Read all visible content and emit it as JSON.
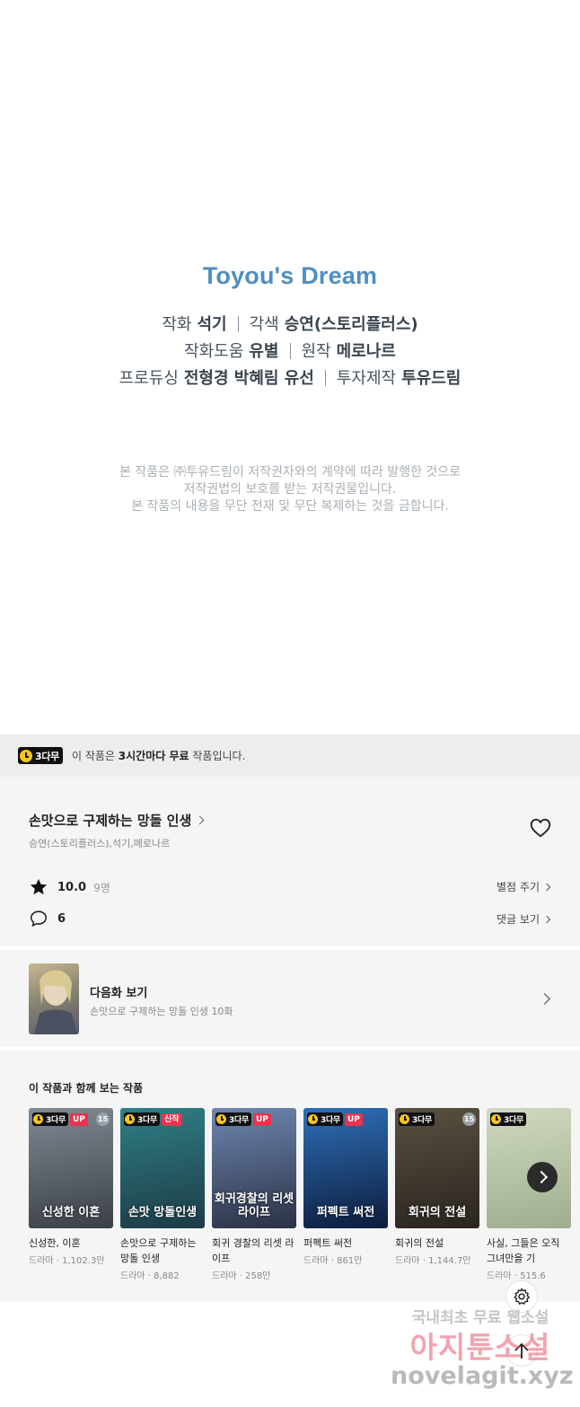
{
  "credits": {
    "logo": "Toyou's Dream",
    "lines": [
      [
        {
          "role": "작화",
          "name": "석기"
        },
        {
          "role": "각색",
          "name": "승연(스토리플러스)"
        }
      ],
      [
        {
          "role": "작화도움",
          "name": "유별"
        },
        {
          "role": "원작",
          "name": "메로나르"
        }
      ],
      [
        {
          "role": "프로듀싱",
          "name": "전형경 박혜림 유선"
        },
        {
          "role": "투자제작",
          "name": "투유드림"
        }
      ]
    ],
    "notice": [
      "본 작품은 ㈜투유드림이 저작권자와의 계약에 따라 발행한 것으로",
      "저작권법의 보호를 받는 저작권물입니다.",
      "본 작품의 내용을 무단 전재 및 무단 복제하는 것을 금합니다."
    ]
  },
  "free_banner": {
    "badge": "3다무",
    "text_before": "이 작품은 ",
    "text_bold": "3시간마다 무료",
    "text_after": " 작품입니다."
  },
  "info": {
    "title": "손맛으로 구제하는 망돌 인생",
    "authors": "승연(스토리플러스),석기,메로나르",
    "rating": "10.0",
    "rating_count": "9명",
    "rate_link": "별점 주기",
    "comments": "6",
    "comments_link": "댓글 보기"
  },
  "next_episode": {
    "label": "다음화 보기",
    "subtitle": "손맛으로 구제하는 망돌 인생 10화"
  },
  "recommendations": {
    "heading": "이 작품과 함께 보는 작품",
    "items": [
      {
        "title": "신성한, 이혼",
        "meta": "드라마 · 1,102.3만",
        "badge": "3다무",
        "tag": "UP",
        "age": "15",
        "cover_text": "신성한 이혼",
        "colors": [
          "#7f8a93",
          "#3b4046"
        ]
      },
      {
        "title": "손맛으로 구제하는 망돌 인생",
        "meta": "드라마 · 8,882",
        "badge": "3다무",
        "tag": "신작",
        "age": "",
        "cover_text": "손맛 망돌인생",
        "colors": [
          "#2f7f86",
          "#1d3b46"
        ]
      },
      {
        "title": "회귀 경찰의 리셋 라이프",
        "meta": "드라마 · 258만",
        "badge": "3다무",
        "tag": "UP",
        "age": "",
        "cover_text": "회귀경찰의 리셋라이프",
        "colors": [
          "#6e86b0",
          "#2b3245"
        ]
      },
      {
        "title": "퍼펙트 써전",
        "meta": "드라마 · 861만",
        "badge": "3다무",
        "tag": "UP",
        "age": "",
        "cover_text": "퍼펙트 써전",
        "colors": [
          "#2e6fb8",
          "#0d1d3c"
        ]
      },
      {
        "title": "회귀의 전설",
        "meta": "드라마 · 1,144.7만",
        "badge": "3다무",
        "tag": "",
        "age": "15",
        "cover_text": "회귀의 전설",
        "colors": [
          "#5a5040",
          "#2a2520"
        ]
      },
      {
        "title": "사실, 그들은 오직 그녀만을 기",
        "meta": "드라마 · 515.6",
        "badge": "3다무",
        "tag": "",
        "age": "",
        "cover_text": "",
        "colors": [
          "#cfd9c0",
          "#9fae8e"
        ]
      }
    ]
  },
  "watermark": {
    "line1": "국내최초 무료 웹소설",
    "line2": "아지툰소설",
    "line3": "novelagit.xyz"
  },
  "colors": {
    "logo_blue": "#4f8ec2",
    "up_red": "#e8344e",
    "badge_yellow": "#f5c518"
  }
}
